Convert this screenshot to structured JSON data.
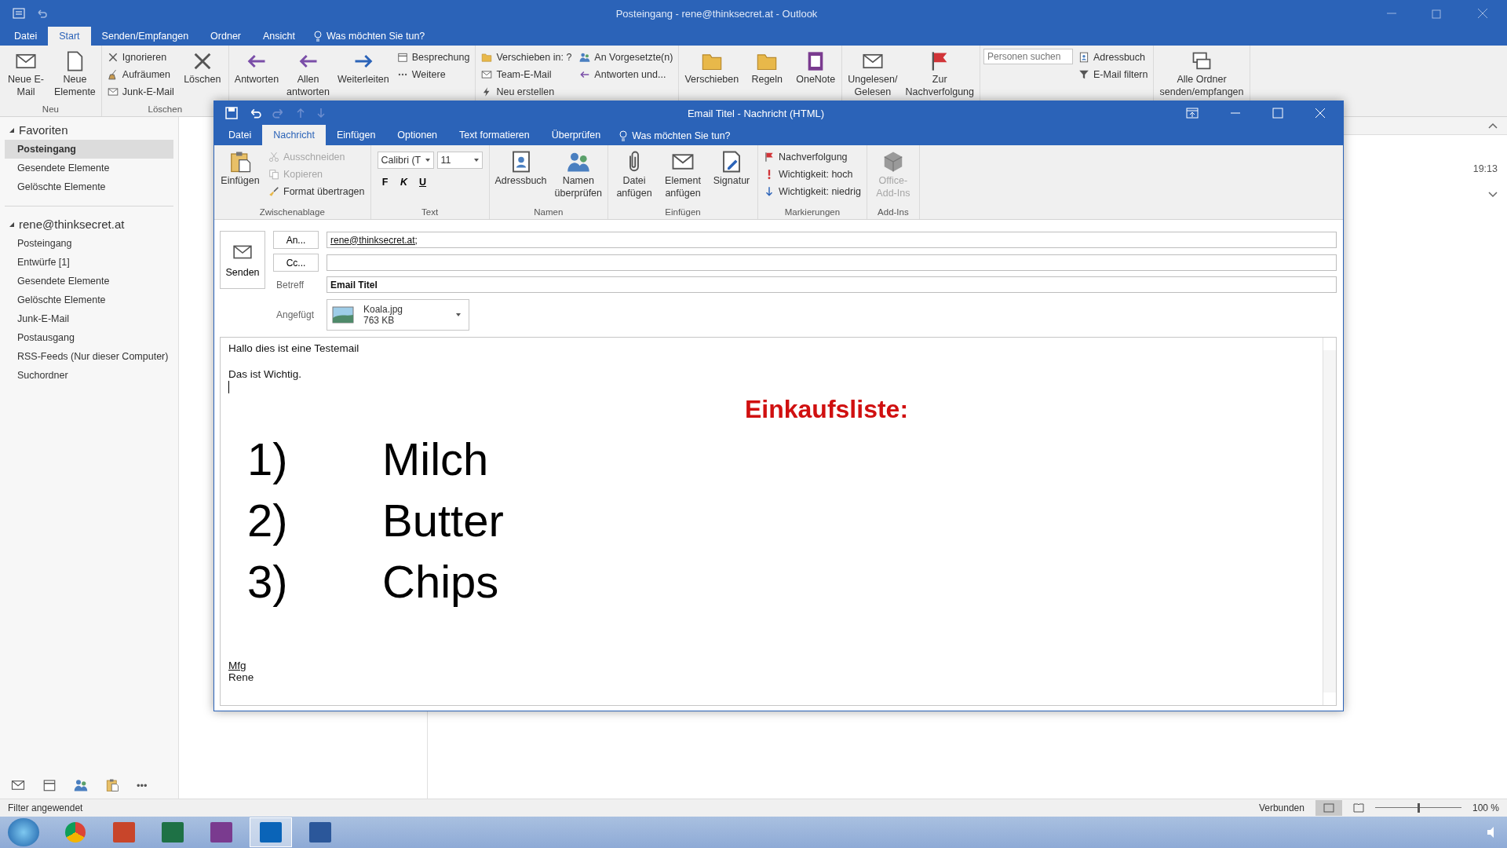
{
  "main_window": {
    "title": "Posteingang - rene@thinksecret.at - Outlook",
    "tabs": [
      {
        "label": "Datei",
        "selected": false
      },
      {
        "label": "Start",
        "selected": true
      },
      {
        "label": "Senden/Empfangen",
        "selected": false
      },
      {
        "label": "Ordner",
        "selected": false
      },
      {
        "label": "Ansicht",
        "selected": false
      }
    ],
    "tell_me": "Was möchten Sie tun?",
    "ribbon": [
      {
        "label": "Neu",
        "items": [
          {
            "kind": "large",
            "label": "Neue E-Mail"
          },
          {
            "kind": "large",
            "label": "Neue Elemente"
          }
        ]
      },
      {
        "label": "Löschen",
        "items": [
          {
            "kind": "small",
            "label": "Ignorieren"
          },
          {
            "kind": "small",
            "label": "Aufräumen"
          },
          {
            "kind": "small",
            "label": "Junk-E-Mail"
          },
          {
            "kind": "large",
            "label": "Löschen"
          }
        ]
      },
      {
        "items": [
          {
            "kind": "large",
            "label": "Antworten"
          },
          {
            "kind": "large",
            "label": "Allen antworten"
          },
          {
            "kind": "large",
            "label": "Weiterleiten"
          },
          {
            "kind": "small",
            "label": "Besprechung"
          },
          {
            "kind": "small",
            "label": "Weitere"
          }
        ]
      },
      {
        "items": [
          {
            "kind": "small",
            "label": "Verschieben in: ?"
          },
          {
            "kind": "small",
            "label": "Team-E-Mail"
          },
          {
            "kind": "small",
            "label": "Neu erstellen"
          },
          {
            "kind": "small",
            "label": "An Vorgesetzte(n)"
          },
          {
            "kind": "small",
            "label": "Antworten und..."
          }
        ]
      },
      {
        "items": [
          {
            "kind": "large",
            "label": "Verschieben"
          },
          {
            "kind": "large",
            "label": "Regeln"
          },
          {
            "kind": "large",
            "label": "OneNote"
          }
        ]
      },
      {
        "items": [
          {
            "kind": "large",
            "label": "Ungelesen/ Gelesen"
          },
          {
            "kind": "large",
            "label": "Zur Nachverfolgung"
          }
        ]
      },
      {
        "items": [
          {
            "kind": "search",
            "placeholder": "Personen suchen"
          },
          {
            "kind": "small",
            "label": "Adressbuch"
          },
          {
            "kind": "small",
            "label": "E-Mail filtern"
          }
        ]
      },
      {
        "items": [
          {
            "kind": "large",
            "label": "Alle Ordner senden/empfangen"
          }
        ]
      }
    ],
    "sidebar": {
      "sections": [
        {
          "title": "Favoriten",
          "expanded": true,
          "items": [
            {
              "label": "Posteingang",
              "selected": true
            },
            {
              "label": "Gesendete Elemente",
              "selected": false
            },
            {
              "label": "Gelöschte Elemente",
              "selected": false
            }
          ]
        },
        {
          "title": "rene@thinksecret.at",
          "expanded": true,
          "items": [
            {
              "label": "Posteingang",
              "selected": false
            },
            {
              "label": "Entwürfe [1]",
              "selected": false
            },
            {
              "label": "Gesendete Elemente",
              "selected": false
            },
            {
              "label": "Gelöschte Elemente",
              "selected": false
            },
            {
              "label": "Junk-E-Mail",
              "selected": false
            },
            {
              "label": "Postausgang",
              "selected": false
            },
            {
              "label": "RSS-Feeds (Nur dieser Computer)",
              "selected": false
            },
            {
              "label": "Suchordner",
              "selected": false
            }
          ]
        }
      ],
      "more": "•••"
    },
    "message_time": "19:13",
    "status_bar": {
      "left": "Filter angewendet",
      "connection": "Verbunden",
      "zoom": "100 %",
      "zoom_slider": {
        "level": 0.5
      }
    }
  },
  "compose_window": {
    "title": "Email Titel - Nachricht (HTML)",
    "tabs": [
      {
        "label": "Datei",
        "selected": false
      },
      {
        "label": "Nachricht",
        "selected": true
      },
      {
        "label": "Einfügen",
        "selected": false
      },
      {
        "label": "Optionen",
        "selected": false
      },
      {
        "label": "Text formatieren",
        "selected": false
      },
      {
        "label": "Überprüfen",
        "selected": false
      }
    ],
    "tell_me": "Was möchten Sie tun?",
    "ribbon": [
      {
        "label": "Zwischenablage",
        "items": [
          {
            "kind": "large",
            "label": "Einfügen",
            "disabled": false
          },
          {
            "kind": "small",
            "label": "Ausschneiden",
            "disabled": true
          },
          {
            "kind": "small",
            "label": "Kopieren",
            "disabled": true
          },
          {
            "kind": "small",
            "label": "Format übertragen",
            "disabled": false
          }
        ]
      },
      {
        "label": "Text",
        "items": [
          {
            "kind": "combo",
            "label": "Calibri (T",
            "disabled": false
          },
          {
            "kind": "combo",
            "label": "11",
            "disabled": false
          },
          {
            "kind": "toggle",
            "label": "F",
            "disabled": false
          },
          {
            "kind": "toggle",
            "label": "K",
            "disabled": false
          },
          {
            "kind": "toggle",
            "label": "U",
            "disabled": false
          }
        ]
      },
      {
        "label": "Namen",
        "items": [
          {
            "kind": "large",
            "label": "Adressbuch",
            "disabled": false
          },
          {
            "kind": "large",
            "label": "Namen überprüfen",
            "disabled": false
          }
        ]
      },
      {
        "label": "Einfügen",
        "items": [
          {
            "kind": "large",
            "label": "Datei anfügen",
            "disabled": false
          },
          {
            "kind": "large",
            "label": "Element anfügen",
            "disabled": false
          },
          {
            "kind": "large",
            "label": "Signatur",
            "disabled": false
          }
        ]
      },
      {
        "label": "Markierungen",
        "items": [
          {
            "kind": "small",
            "label": "Nachverfolgung",
            "disabled": false
          },
          {
            "kind": "small",
            "label": "Wichtigkeit: hoch",
            "disabled": false
          },
          {
            "kind": "small",
            "label": "Wichtigkeit: niedrig",
            "disabled": false
          }
        ]
      },
      {
        "label": "Add-Ins",
        "items": [
          {
            "kind": "large",
            "label": "Office-Add-Ins",
            "disabled": true
          }
        ]
      }
    ],
    "send_button": "Senden",
    "to_button": "An...",
    "cc_button": "Cc...",
    "to_value": "rene@thinksecret.at;",
    "subject_label": "Betreff",
    "subject_value": "Email Titel",
    "attached_label": "Angefügt",
    "attachment": {
      "name": "Koala.jpg",
      "size": "763 KB"
    },
    "body": {
      "lines": [
        "Hallo dies ist eine Testemail",
        "Das ist Wichtig."
      ],
      "heading": "Einkaufsliste:",
      "list": [
        {
          "number": "1)",
          "text": "Milch"
        },
        {
          "number": "2)",
          "text": "Butter"
        },
        {
          "number": "3)",
          "text": "Chips"
        }
      ],
      "signature": [
        "Mfg",
        "Rene"
      ]
    }
  }
}
